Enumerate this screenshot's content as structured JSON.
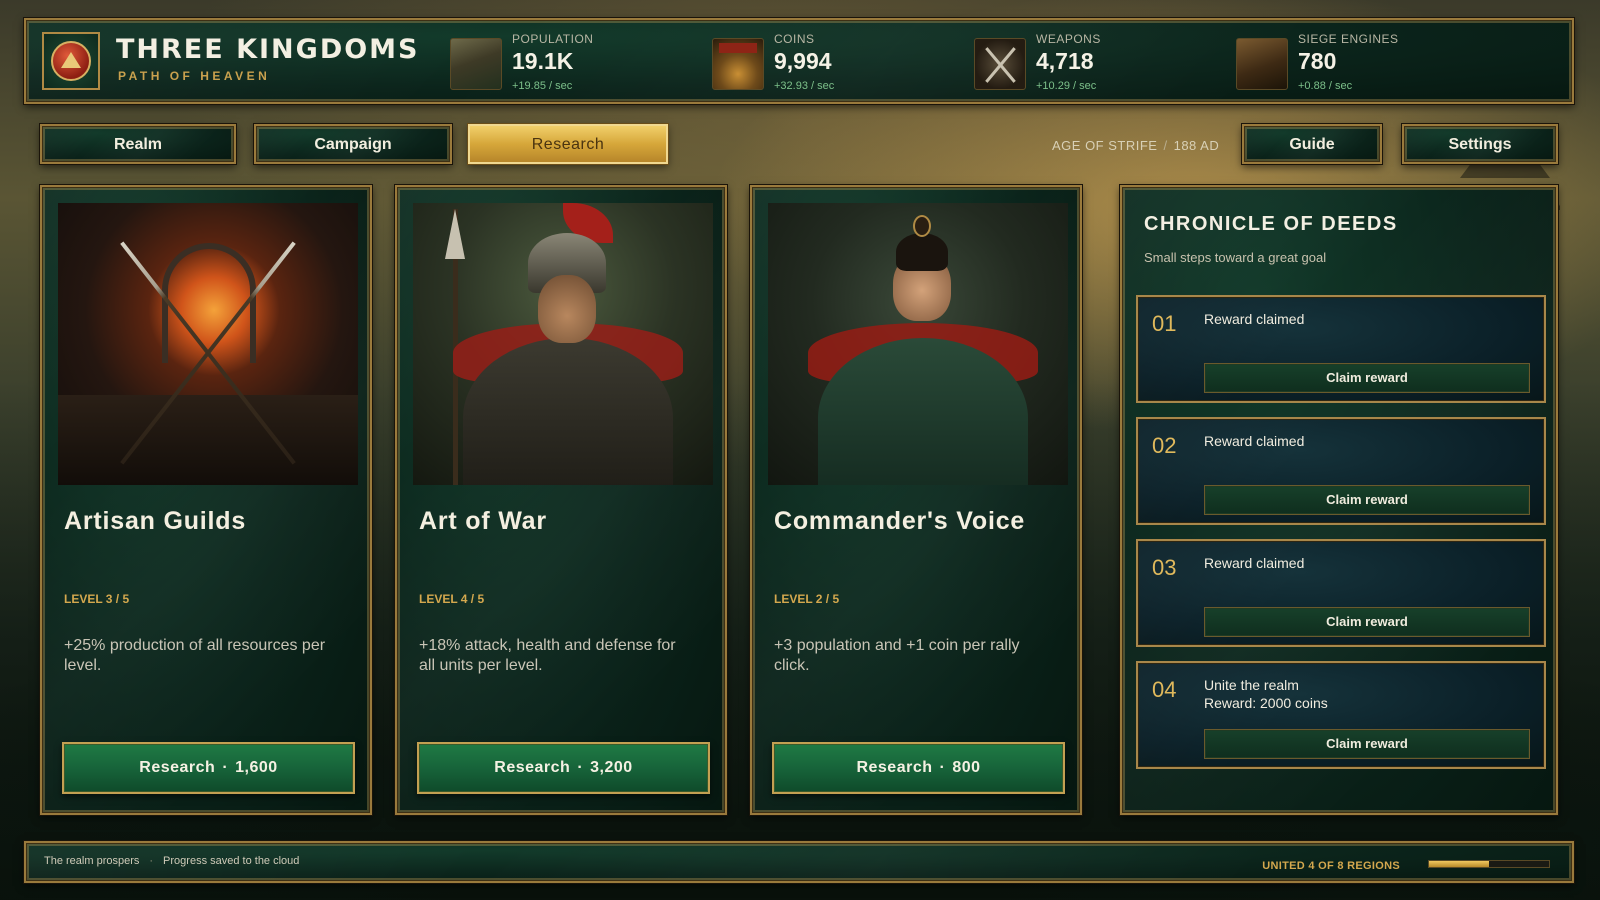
{
  "header": {
    "title": "THREE KINGDOMS",
    "subtitle": "PATH OF HEAVEN",
    "resources": [
      {
        "label": "POPULATION",
        "value": "19.1K",
        "rate": "+19.85 / sec",
        "icon": "village-icon"
      },
      {
        "label": "COINS",
        "value": "9,994",
        "rate": "+32.93 / sec",
        "icon": "coin-hoard-icon"
      },
      {
        "label": "WEAPONS",
        "value": "4,718",
        "rate": "+10.29 / sec",
        "icon": "crossed-swords-icon"
      },
      {
        "label": "SIEGE ENGINES",
        "value": "780",
        "rate": "+0.88 / sec",
        "icon": "catapult-icon"
      }
    ]
  },
  "nav": {
    "tabs": [
      {
        "label": "Realm",
        "active": false
      },
      {
        "label": "Campaign",
        "active": false
      },
      {
        "label": "Research",
        "active": true
      }
    ],
    "era": "AGE OF STRIFE",
    "era_sep": "/",
    "year": "188 AD",
    "guide": "Guide",
    "settings": "Settings"
  },
  "research": {
    "dot": "·",
    "cards": [
      {
        "title": "Artisan Guilds",
        "level": "LEVEL 3 / 5",
        "description": "+25% production of all resources per level.",
        "button_label": "Research",
        "cost": "1,600"
      },
      {
        "title": "Art of War",
        "level": "LEVEL 4 / 5",
        "description": "+18% attack, health and defense for all units per level.",
        "button_label": "Research",
        "cost": "3,200"
      },
      {
        "title": "Commander's Voice",
        "level": "LEVEL 2 / 5",
        "description": "+3 population and +1 coin per rally click.",
        "button_label": "Research",
        "cost": "800"
      }
    ]
  },
  "chronicle": {
    "title": "CHRONICLE OF DEEDS",
    "subtitle": "Small steps toward a great goal",
    "quests": [
      {
        "num": "01",
        "text": "Reward claimed",
        "button": "Claim reward"
      },
      {
        "num": "02",
        "text": "Reward claimed",
        "button": "Claim reward"
      },
      {
        "num": "03",
        "text": "Reward claimed",
        "button": "Claim reward"
      },
      {
        "num": "04",
        "text": "Unite the realm\nReward: 2000 coins",
        "button": "Claim reward"
      }
    ]
  },
  "footer": {
    "status_left": "The realm prospers",
    "status_dot": "·",
    "status_right": "Progress saved to the cloud",
    "regions": "UNITED 4 OF 8 REGIONS",
    "progress_fraction": 0.5
  },
  "colors": {
    "gold": "#c9a14e",
    "jade": "#0b241b",
    "research_green": "#17643a",
    "active_tab_gold": "#d6a73a",
    "rate_green": "#7cc08a"
  }
}
